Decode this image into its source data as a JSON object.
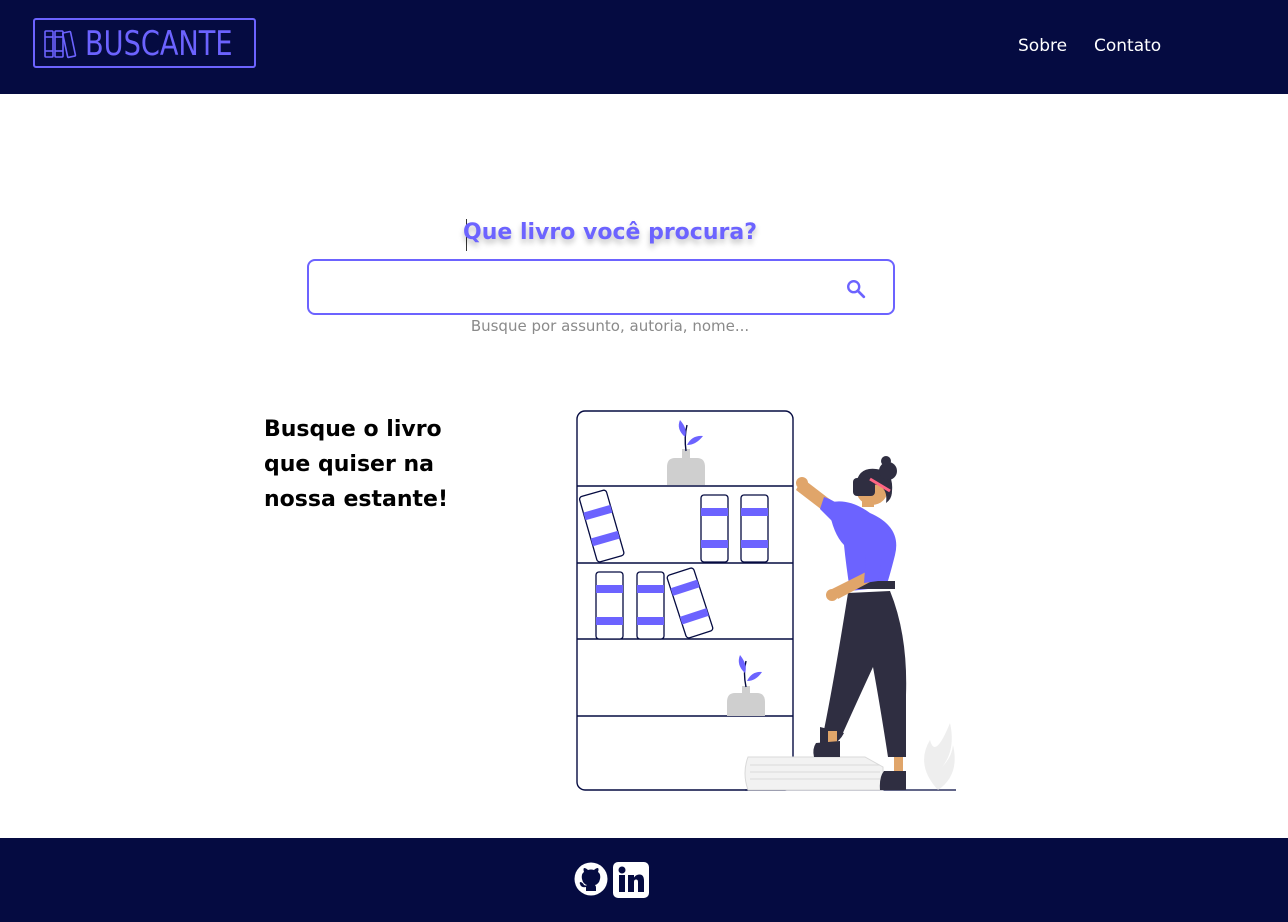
{
  "header": {
    "logo_text": "BUSCANTE",
    "nav": [
      {
        "label": "Sobre"
      },
      {
        "label": "Contato"
      }
    ]
  },
  "search": {
    "heading": "Que livro você procura?",
    "value": "",
    "placeholder": "",
    "hint": "Busque por assunto, autoria, nome..."
  },
  "hero": {
    "tagline": "Busque o livro\nque quiser na\nnossa estante!"
  },
  "footer": {
    "icons": [
      "github-icon",
      "linkedin-icon"
    ]
  },
  "colors": {
    "navy": "#050b41",
    "accent": "#6c63ff"
  }
}
